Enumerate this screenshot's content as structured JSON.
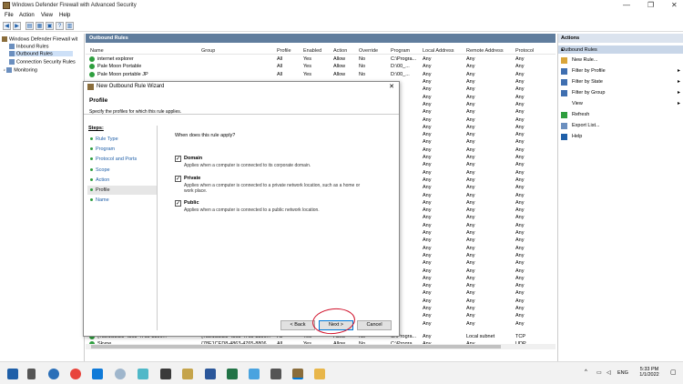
{
  "window": {
    "title": "Windows Defender Firewall with Advanced Security"
  },
  "menu": [
    "File",
    "Action",
    "View",
    "Help"
  ],
  "tree": {
    "root": "Windows Defender Firewall wit",
    "items": [
      "Inbound Rules",
      "Outbound Rules",
      "Connection Security Rules",
      "Monitoring"
    ]
  },
  "main": {
    "header": "Outbound Rules",
    "columns": [
      "Name",
      "Group",
      "Profile",
      "Enabled",
      "Action",
      "Override",
      "Program",
      "Local Address",
      "Remote Address",
      "Protocol"
    ],
    "rows": [
      [
        "internet explorer",
        "",
        "All",
        "Yes",
        "Allow",
        "No",
        "C:\\Progra...",
        "Any",
        "Any",
        "Any"
      ],
      [
        "Pale Moon Portable",
        "",
        "All",
        "Yes",
        "Allow",
        "No",
        "D:\\00_...",
        "Any",
        "Any",
        "Any"
      ],
      [
        "Pale Moon portable JP",
        "",
        "All",
        "Yes",
        "Allow",
        "No",
        "D:\\00_...",
        "Any",
        "Any",
        "Any"
      ]
    ],
    "bg_rows": [
      [
        "Any",
        "Any",
        "Any"
      ],
      [
        "Any",
        "Any",
        "Any"
      ],
      [
        "Any",
        "Any",
        "Any"
      ],
      [
        "Any",
        "Any",
        "Any"
      ],
      [
        "Any",
        "Any",
        "Any"
      ],
      [
        "Any",
        "Any",
        "Any"
      ],
      [
        "Any",
        "Any",
        "Any"
      ],
      [
        "Any",
        "Any",
        "Any"
      ],
      [
        "Any",
        "Any",
        "Any"
      ],
      [
        "Any",
        "Any",
        "Any"
      ],
      [
        "Any",
        "Any",
        "Any"
      ],
      [
        "Any",
        "Any",
        "Any"
      ],
      [
        "Any",
        "Any",
        "Any"
      ],
      [
        "Any",
        "Any",
        "Any"
      ],
      [
        "Any",
        "Any",
        "Any"
      ],
      [
        "Any",
        "Any",
        "Any"
      ],
      [
        "Any",
        "Any",
        "Any"
      ],
      [
        "Any",
        "Any",
        "Any"
      ],
      [
        "Any",
        "Any",
        "Any"
      ],
      [
        "Any",
        "Any",
        "Any"
      ],
      [
        "Any",
        "Any",
        "Any"
      ],
      [
        "Any",
        "Any",
        "Any"
      ],
      [
        "Any",
        "Any",
        "Any"
      ],
      [
        "Any",
        "Any",
        "Any"
      ],
      [
        "Any",
        "Any",
        "Any"
      ],
      [
        "Any",
        "Any",
        "Any"
      ],
      [
        "Any",
        "Any",
        "Any"
      ],
      [
        "Any",
        "Any",
        "Any"
      ],
      [
        "Any",
        "Any",
        "Any"
      ],
      [
        "Any",
        "Any",
        "Any"
      ],
      [
        "Any",
        "Any",
        "Any"
      ],
      [
        "Any",
        "Any",
        "Any"
      ],
      [
        "Any",
        "Any",
        "Any"
      ]
    ],
    "bottom_rows": [
      [
        "{78E1CED8-4863-4765-8806...",
        "{78E1CED8-4863-4765-8806...",
        "All",
        "Yes",
        "Allow",
        "No",
        "C:\\Progra...",
        "Any",
        "Local subnet",
        "TCP"
      ],
      [
        "Skype",
        "{78E1CED8-4863-4765-8806...",
        "All",
        "Yes",
        "Allow",
        "No",
        "C:\\Progra...",
        "Any",
        "Any",
        "UDP"
      ]
    ]
  },
  "actions": {
    "header": "Actions",
    "section": "Outbound Rules",
    "items": [
      {
        "label": "New Rule...",
        "icon": "new-rule-icon"
      },
      {
        "label": "Filter by Profile",
        "icon": "filter-icon",
        "sub": true
      },
      {
        "label": "Filter by State",
        "icon": "filter-icon",
        "sub": true
      },
      {
        "label": "Filter by Group",
        "icon": "filter-icon",
        "sub": true
      },
      {
        "label": "View",
        "icon": "",
        "sub": true
      },
      {
        "label": "Refresh",
        "icon": "refresh-icon"
      },
      {
        "label": "Export List...",
        "icon": "export-icon"
      },
      {
        "label": "Help",
        "icon": "help-icon"
      }
    ]
  },
  "wizard": {
    "title": "New Outbound Rule Wizard",
    "heading": "Profile",
    "subheading": "Specify the profiles for which this rule applies.",
    "steps_header": "Steps:",
    "steps": [
      "Rule Type",
      "Program",
      "Protocol and Ports",
      "Scope",
      "Action",
      "Profile",
      "Name"
    ],
    "current_step": "Profile",
    "question": "When does this rule apply?",
    "options": [
      {
        "label": "Domain",
        "checked": true,
        "desc": "Applies when a computer is connected to its corporate domain."
      },
      {
        "label": "Private",
        "checked": true,
        "desc": "Applies when a computer is connected to a private network location, such as a home or work place."
      },
      {
        "label": "Public",
        "checked": true,
        "desc": "Applies when a computer is connected to a public network location."
      }
    ],
    "back_label": "< Back",
    "next_label": "Next >",
    "cancel_label": "Cancel"
  },
  "taskbar": {
    "language": "ENG",
    "time": "5:33 PM",
    "date": "1/1/2022"
  }
}
